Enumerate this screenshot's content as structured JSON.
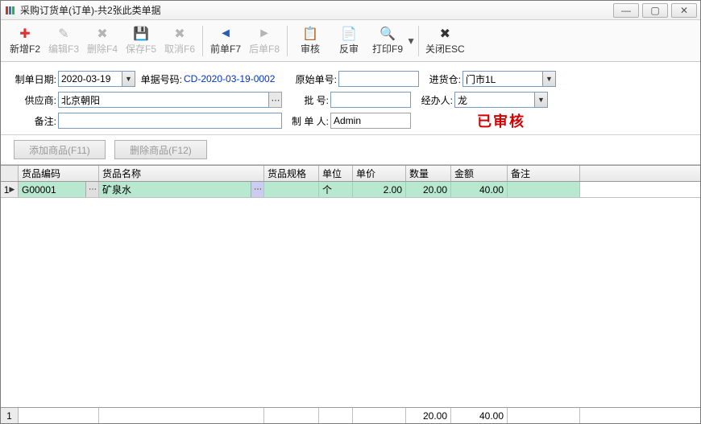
{
  "window": {
    "title": "采购订货单(订单)-共2张此类单据"
  },
  "toolbar": {
    "new": "新增F2",
    "edit": "编辑F3",
    "del": "删除F4",
    "save": "保存F5",
    "cancel": "取消F6",
    "prev": "前单F7",
    "next": "后单F8",
    "audit": "审核",
    "unaudit": "反审",
    "print": "打印F9",
    "close": "关闭ESC"
  },
  "labels": {
    "date": "制单日期:",
    "docno": "单据号码:",
    "origno": "原始单号:",
    "wh": "进货仓:",
    "supplier": "供应商:",
    "batch": "批    号:",
    "handler": "经办人:",
    "remark": "备注:",
    "maker": "制 单 人:"
  },
  "form": {
    "date": "2020-03-19",
    "docno": "CD-2020-03-19-0002",
    "origno": "",
    "wh": "门市1L",
    "supplier": "北京朝阳",
    "batch": "",
    "handler": "龙",
    "remark": "",
    "maker": "Admin"
  },
  "stamp": "已审核",
  "buttons": {
    "add": "添加商品(F11)",
    "del": "删除商品(F12)"
  },
  "grid": {
    "headers": {
      "code": "货品编码",
      "name": "货品名称",
      "spec": "货品规格",
      "unit": "单位",
      "price": "单价",
      "qty": "数量",
      "amt": "金额",
      "note": "备注"
    },
    "rows": [
      {
        "idx": "1",
        "code": "G00001",
        "name": "矿泉水",
        "spec": "",
        "unit": "个",
        "price": "2.00",
        "qty": "20.00",
        "amt": "40.00",
        "note": ""
      }
    ],
    "footer": {
      "idx": "1",
      "qty": "20.00",
      "amt": "40.00"
    }
  }
}
